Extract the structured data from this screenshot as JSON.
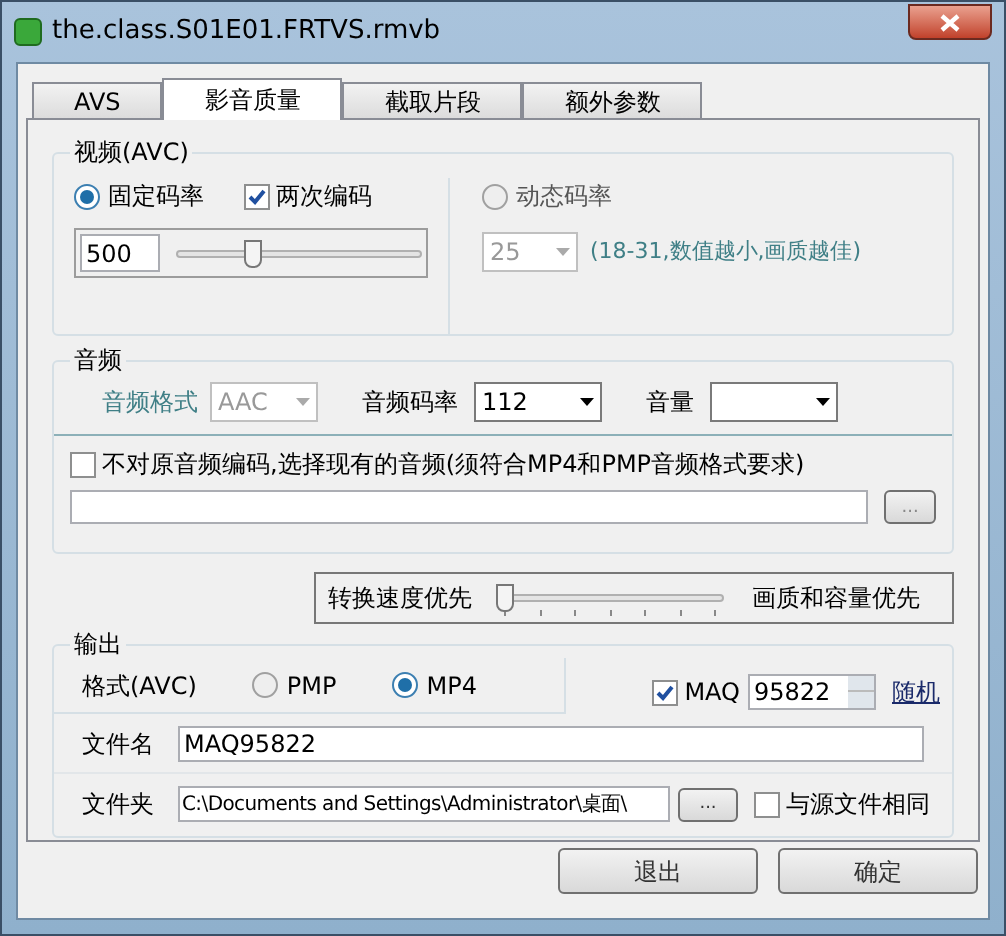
{
  "window": {
    "title": "the.class.S01E01.FRTVS.rmvb"
  },
  "tabs": [
    {
      "label": "AVS",
      "selected": false
    },
    {
      "label": "影音质量",
      "selected": true
    },
    {
      "label": "截取片段",
      "selected": false
    },
    {
      "label": "额外参数",
      "selected": false
    }
  ],
  "video": {
    "title": "视频(AVC)",
    "modes": [
      {
        "label": "固定码率",
        "selected": true
      },
      {
        "label": "动态码率",
        "selected": false
      }
    ],
    "two_pass": {
      "label": "两次编码",
      "checked": true
    },
    "bitrate": {
      "value": "500",
      "level": 0.3
    },
    "quality": {
      "value": "25",
      "disabled": true
    },
    "hint": "(18-31,数值越小,画质越佳)"
  },
  "audio": {
    "title": "音频",
    "format": {
      "label": "音频格式",
      "value": "AAC",
      "disabled": true
    },
    "bitrate": {
      "label": "音频码率",
      "value": "112"
    },
    "volume": {
      "label": "音量"
    },
    "copy_audio": {
      "label": "不对原音频编码,选择现有的音频(须符合MP4和PMP音频格式要求)",
      "checked": false
    },
    "browse": "..."
  },
  "speed": {
    "left_label": "转换速度优先",
    "right_label": "画质和容量优先",
    "level": 0
  },
  "output": {
    "title": "输出",
    "format_label": "格式(AVC)",
    "formats": [
      {
        "label": "PMP",
        "selected": false
      },
      {
        "label": "MP4",
        "selected": true
      }
    ],
    "maq": {
      "label": "MAQ",
      "checked": true,
      "value": "95822"
    },
    "random_link": "随机",
    "filename": {
      "label": "文件名",
      "value": "MAQ95822"
    },
    "folder": {
      "label": "文件夹",
      "value": "C:\\Documents and Settings\\Administrator\\桌面\\",
      "browse": "..."
    },
    "same_as_source": {
      "label": "与源文件相同",
      "checked": false
    }
  },
  "buttons": [
    {
      "label": "退出"
    },
    {
      "label": "确定"
    }
  ]
}
